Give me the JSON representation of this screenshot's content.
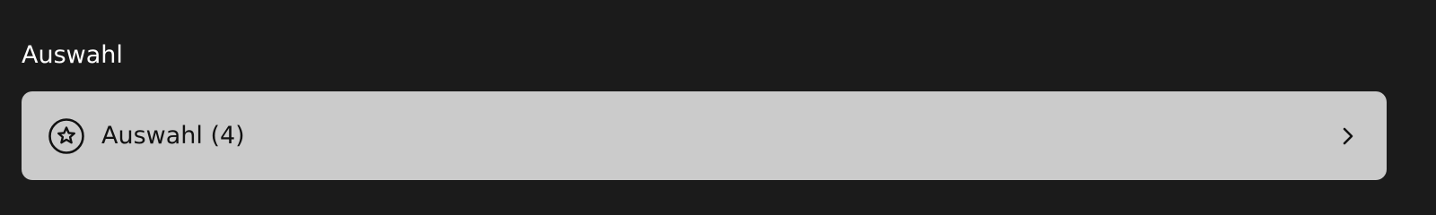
{
  "section": {
    "title": "Auswahl"
  },
  "selection_row": {
    "label": "Auswahl (4)",
    "icon": "star-circle-icon",
    "trailing_icon": "chevron-right-icon"
  },
  "colors": {
    "background": "#1b1b1b",
    "row_background": "#cbcbcb",
    "text_light": "#ffffff",
    "text_dark": "#111111"
  }
}
